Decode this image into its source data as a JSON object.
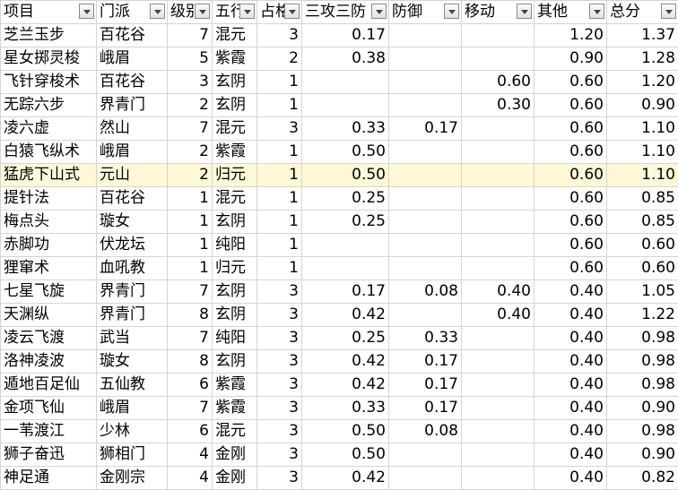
{
  "headers": [
    "项目",
    "门派",
    "级别",
    "五行",
    "占格",
    "三攻三防",
    "防御",
    "移动",
    "其他",
    "总分"
  ],
  "rows": [
    [
      "芝兰玉步",
      "百花谷",
      "7",
      "混元",
      "3",
      "0.17",
      "",
      "",
      "1.20",
      "1.37"
    ],
    [
      "星女掷灵梭",
      "峨眉",
      "5",
      "紫霞",
      "2",
      "0.38",
      "",
      "",
      "0.90",
      "1.28"
    ],
    [
      "飞针穿梭术",
      "百花谷",
      "3",
      "玄阴",
      "1",
      "",
      "",
      "0.60",
      "0.60",
      "1.20"
    ],
    [
      "无踪六步",
      "界青门",
      "2",
      "玄阴",
      "1",
      "",
      "",
      "0.30",
      "0.60",
      "0.90"
    ],
    [
      "凌六虚",
      "然山",
      "7",
      "混元",
      "3",
      "0.33",
      "0.17",
      "",
      "0.60",
      "1.10"
    ],
    [
      "白猿飞纵术",
      "峨眉",
      "2",
      "紫霞",
      "1",
      "0.50",
      "",
      "",
      "0.60",
      "1.10"
    ],
    [
      "猛虎下山式",
      "元山",
      "2",
      "归元",
      "1",
      "0.50",
      "",
      "",
      "0.60",
      "1.10"
    ],
    [
      "提针法",
      "百花谷",
      "1",
      "混元",
      "1",
      "0.25",
      "",
      "",
      "0.60",
      "0.85"
    ],
    [
      "梅点头",
      "璇女",
      "1",
      "玄阴",
      "1",
      "0.25",
      "",
      "",
      "0.60",
      "0.85"
    ],
    [
      "赤脚功",
      "伏龙坛",
      "1",
      "纯阳",
      "1",
      "",
      "",
      "",
      "0.60",
      "0.60"
    ],
    [
      "狸窜术",
      "血吼教",
      "1",
      "归元",
      "1",
      "",
      "",
      "",
      "0.60",
      "0.60"
    ],
    [
      "七星飞旋",
      "界青门",
      "7",
      "玄阴",
      "3",
      "0.17",
      "0.08",
      "0.40",
      "0.40",
      "1.05"
    ],
    [
      "天渊纵",
      "界青门",
      "8",
      "玄阴",
      "3",
      "0.42",
      "",
      "0.40",
      "0.40",
      "1.22"
    ],
    [
      "凌云飞渡",
      "武当",
      "7",
      "纯阳",
      "3",
      "0.25",
      "0.33",
      "",
      "0.40",
      "0.98"
    ],
    [
      "洛神凌波",
      "璇女",
      "8",
      "玄阴",
      "3",
      "0.42",
      "0.17",
      "",
      "0.40",
      "0.98"
    ],
    [
      "遁地百足仙",
      "五仙教",
      "6",
      "紫霞",
      "3",
      "0.42",
      "0.17",
      "",
      "0.40",
      "0.98"
    ],
    [
      "金项飞仙",
      "峨眉",
      "7",
      "紫霞",
      "3",
      "0.33",
      "0.17",
      "",
      "0.40",
      "0.90"
    ],
    [
      "一苇渡江",
      "少林",
      "6",
      "混元",
      "3",
      "0.50",
      "0.08",
      "",
      "0.40",
      "0.98"
    ],
    [
      "狮子奋迅",
      "狮相门",
      "4",
      "金刚",
      "3",
      "0.50",
      "",
      "",
      "0.40",
      "0.90"
    ],
    [
      "神足通",
      "金刚宗",
      "4",
      "金刚",
      "3",
      "0.42",
      "",
      "",
      "0.40",
      "0.82"
    ]
  ],
  "highlighted_row": 6,
  "colors": {
    "grid": "#d4d4d4",
    "highlight": "#fff8d6"
  }
}
